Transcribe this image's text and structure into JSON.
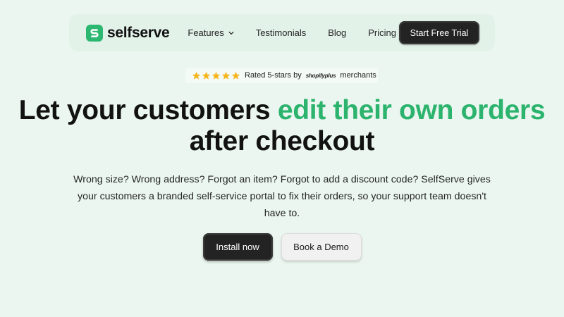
{
  "brand": {
    "name": "selfserve",
    "logo_icon": "selfserve-logo-icon",
    "color": "#2db872"
  },
  "nav": {
    "items": [
      {
        "label": "Features",
        "has_dropdown": true
      },
      {
        "label": "Testimonials"
      },
      {
        "label": "Blog"
      },
      {
        "label": "Pricing"
      }
    ],
    "cta_label": "Start Free Trial"
  },
  "rating": {
    "stars": 5,
    "text_before": "Rated 5-stars by",
    "platform": "shopifyplus",
    "text_after": "merchants",
    "star_color": "#f6b621"
  },
  "hero": {
    "title_part1": "Let your customers ",
    "title_accent": "edit their own orders",
    "title_part2": " after checkout",
    "accent_color": "#2cb36d",
    "subtitle": "Wrong size? Wrong address? Forgot an item? Forgot to add a discount code? SelfServe gives your customers a branded self-service portal to fix their orders, so your support team doesn't have to."
  },
  "actions": {
    "primary_label": "Install now",
    "secondary_label": "Book a Demo"
  }
}
